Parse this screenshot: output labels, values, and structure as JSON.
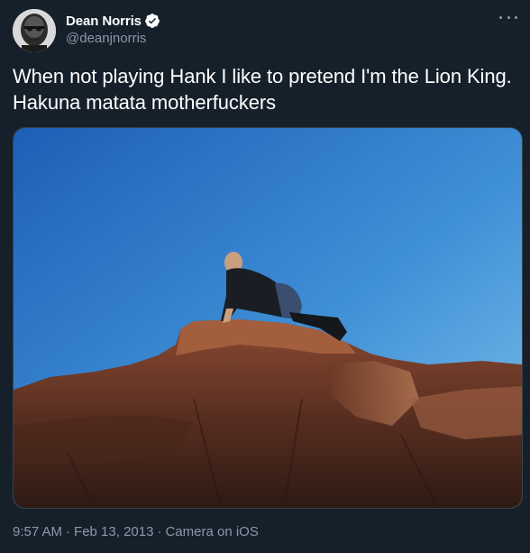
{
  "author": {
    "display_name": "Dean Norris",
    "handle": "@deanjnorris",
    "verified": true,
    "avatar": "profile-photo"
  },
  "tweet": {
    "text": "When not playing Hank I like to pretend I'm the Lion King. Hakuna matata motherfuckers",
    "time": "9:57 AM",
    "date": "Feb 13, 2013",
    "source": "Camera on iOS",
    "separator": "·"
  },
  "media": {
    "type": "photo",
    "description_icon": "photo"
  },
  "icons": {
    "more": "more-horizontal-icon",
    "verified": "verified-badge-icon"
  },
  "colors": {
    "background": "#15202b",
    "primary_text": "#ffffff",
    "secondary_text": "#8b98a5",
    "border": "#38444d",
    "verified": "#ffffff"
  }
}
